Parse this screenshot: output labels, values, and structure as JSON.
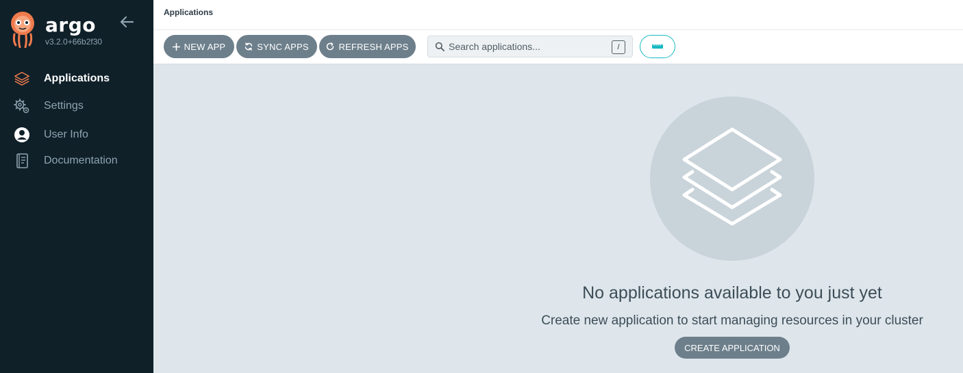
{
  "app": {
    "brand": "argo",
    "version": "v3.2.0+66b2f30"
  },
  "sidebar": {
    "items": [
      {
        "label": "Applications",
        "icon": "layers-icon",
        "active": true
      },
      {
        "label": "Settings",
        "icon": "gears-icon",
        "active": false
      },
      {
        "label": "User Info",
        "icon": "user-circle-icon",
        "active": false
      },
      {
        "label": "Documentation",
        "icon": "book-icon",
        "active": false
      }
    ]
  },
  "header": {
    "title": "Applications"
  },
  "toolbar": {
    "new_app_label": "NEW APP",
    "sync_apps_label": "SYNC APPS",
    "refresh_apps_label": "REFRESH APPS",
    "search_placeholder": "Search applications...",
    "search_shortcut": "/"
  },
  "empty_state": {
    "title": "No applications available to you just yet",
    "subtitle": "Create new application to start managing resources in your cluster",
    "button_label": "CREATE APPLICATION"
  },
  "colors": {
    "sidebar_bg": "#0f2029",
    "content_bg": "#dee6eb",
    "button_bg": "#6d7f8b",
    "accent": "#18b8c4",
    "logo_orange": "#ef7b4d"
  }
}
